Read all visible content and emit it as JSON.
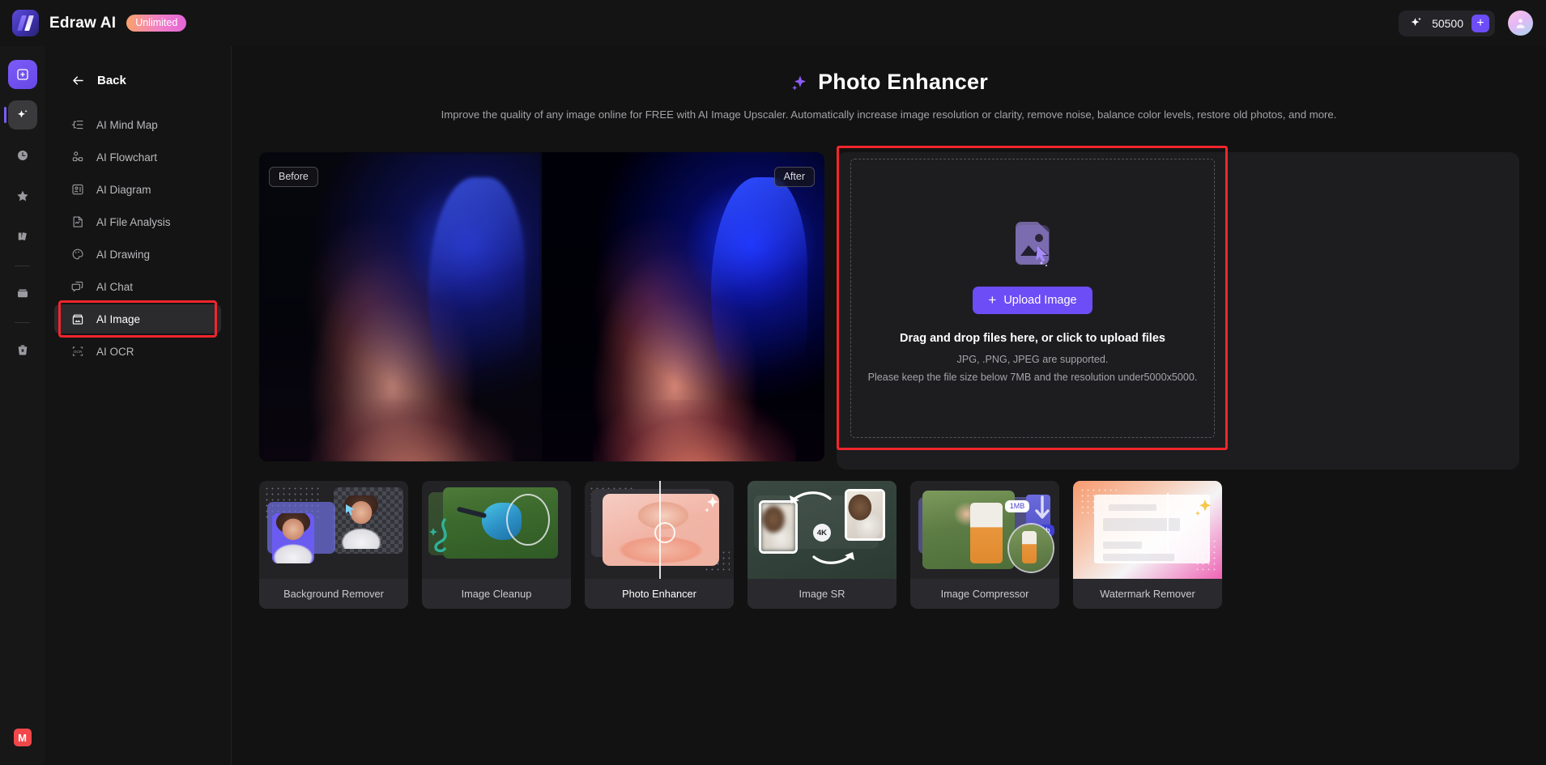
{
  "topbar": {
    "brand_name": "Edraw AI",
    "badge": "Unlimited",
    "credits": "50500",
    "credits_icon": "sparkle-icon",
    "add_credits_label": "+",
    "avatar_icon": "user-avatar-icon"
  },
  "rail": {
    "items": [
      {
        "name": "new-document",
        "icon": "plus-square-icon"
      },
      {
        "name": "ai-tools",
        "icon": "sparkles-icon"
      },
      {
        "name": "recent",
        "icon": "clock-icon"
      },
      {
        "name": "favorites",
        "icon": "star-icon"
      },
      {
        "name": "templates",
        "icon": "templates-icon"
      },
      {
        "name": "my-files",
        "icon": "folder-icon"
      },
      {
        "name": "trash",
        "icon": "trash-icon"
      }
    ],
    "bottom_badge": "M"
  },
  "nav": {
    "back_label": "Back",
    "back_icon": "arrow-left-icon",
    "items": [
      {
        "label": "AI Mind Map",
        "icon": "mindmap-icon",
        "selected": false
      },
      {
        "label": "AI Flowchart",
        "icon": "flowchart-icon",
        "selected": false
      },
      {
        "label": "AI Diagram",
        "icon": "diagram-icon",
        "selected": false
      },
      {
        "label": "AI File Analysis",
        "icon": "file-analysis-icon",
        "selected": false
      },
      {
        "label": "AI Drawing",
        "icon": "palette-icon",
        "selected": false
      },
      {
        "label": "AI Chat",
        "icon": "chat-icon",
        "selected": false
      },
      {
        "label": "AI Image",
        "icon": "image-icon",
        "selected": true
      },
      {
        "label": "AI OCR",
        "icon": "ocr-icon",
        "selected": false
      }
    ]
  },
  "main": {
    "title": "Photo Enhancer",
    "title_icon": "sparkle-icon",
    "description": "Improve the quality of any image online for FREE with AI Image Upscaler. Automatically increase image resolution or clarity, remove noise, balance color levels, restore old photos, and more.",
    "preview": {
      "before_label": "Before",
      "after_label": "After"
    },
    "uploader": {
      "icon": "image-upload-icon",
      "button_label": "Upload Image",
      "button_plus": "+",
      "title": "Drag and drop files here, or click to upload files",
      "formats_line": "JPG, .PNG, JPEG are supported.",
      "limits_line": "Please keep the file size below 7MB and the resolution under5000x5000."
    }
  },
  "cards": [
    {
      "label": "Background Remover",
      "selected": false
    },
    {
      "label": "Image Cleanup",
      "selected": false
    },
    {
      "label": "Photo Enhancer",
      "selected": true
    },
    {
      "label": "Image SR",
      "selected": false,
      "badge": "4K"
    },
    {
      "label": "Image Compressor",
      "selected": false,
      "badge_before": "1MB",
      "badge_after": "100kb"
    },
    {
      "label": "Watermark Remover",
      "selected": false
    }
  ],
  "colors": {
    "accent": "#6c4df6",
    "highlight": "#f2262c",
    "background": "#121212",
    "panel": "#141414",
    "card": "#232326"
  }
}
